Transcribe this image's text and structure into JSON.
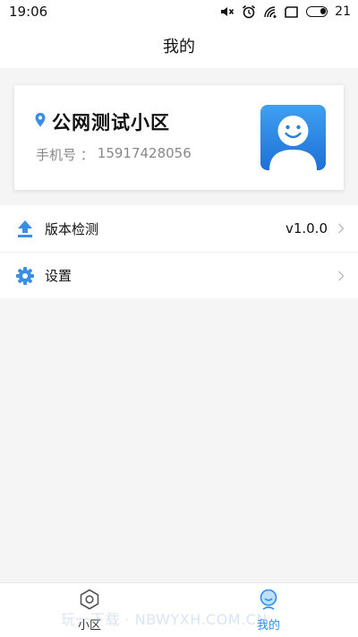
{
  "status_bar": {
    "time": "19:06",
    "battery_level": "21"
  },
  "header": {
    "title": "我的"
  },
  "profile": {
    "community_name": "公网测试小区",
    "phone_label": "手机号 ：",
    "phone_number": "15917428056"
  },
  "menu": {
    "items": [
      {
        "label": "版本检测",
        "value": "v1.0.0",
        "icon": "upload-arrow-icon"
      },
      {
        "label": "设置",
        "value": "",
        "icon": "gear-icon"
      }
    ]
  },
  "tabbar": {
    "tabs": [
      {
        "label": "小区",
        "icon": "hexagon-icon",
        "active": false
      },
      {
        "label": "我的",
        "icon": "smile-user-icon",
        "active": true
      }
    ]
  },
  "watermark": "玩一下载 · NBWYXH.COM.CN",
  "colors": {
    "accent": "#2f8ef0",
    "background": "#f5f5f5"
  }
}
